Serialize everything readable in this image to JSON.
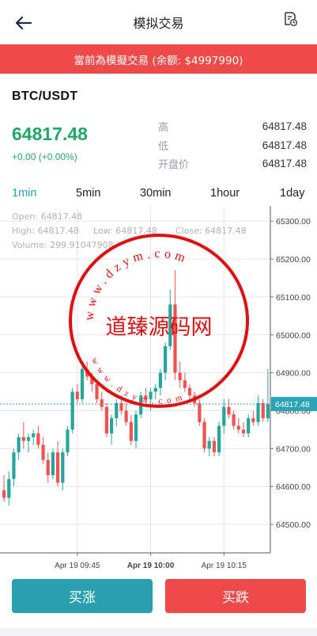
{
  "header": {
    "title": "模拟交易",
    "back_icon": "arrow-left-icon",
    "record_icon": "order-record-icon"
  },
  "banner": {
    "text": "當前為模擬交易 (余额: $4997990)"
  },
  "ticker": {
    "pair": "BTC/USDT",
    "price": "64817.48",
    "change": "+0.00 (+0.00%)",
    "stats": [
      {
        "label": "高",
        "value": "64817.48"
      },
      {
        "label": "低",
        "value": "64817.48"
      },
      {
        "label": "开盘价",
        "value": "64817.48"
      }
    ]
  },
  "tabs": [
    {
      "label": "1min",
      "active": true
    },
    {
      "label": "5min",
      "active": false
    },
    {
      "label": "30min",
      "active": false
    },
    {
      "label": "1hour",
      "active": false
    },
    {
      "label": "1day",
      "active": false
    }
  ],
  "ohlc": {
    "open": "Open:  64817.48",
    "high": "High:  64817.48",
    "low": "Low:  64817.48",
    "close": "Close:  64817.48",
    "volume": "Volume:  299.91047908"
  },
  "chart_data": {
    "type": "candlestick",
    "y_ticks": [
      "65300.00",
      "65200.00",
      "65100.00",
      "65000.00",
      "64900.00",
      "64800.00",
      "64700.00",
      "64600.00",
      "64500.00"
    ],
    "y_tick_values": [
      65300,
      65200,
      65100,
      65000,
      64900,
      64800,
      64700,
      64600,
      64500
    ],
    "ylim": [
      64425,
      65340
    ],
    "x_ticks": [
      "Apr 19 09:45",
      "Apr 19 10:00",
      "Apr 19 10:15"
    ],
    "x_tick_index": [
      15,
      30,
      45
    ],
    "current_price": 64817.48,
    "current_price_label": "64817.48",
    "up_color": "#26a69a",
    "down_color": "#ef5350",
    "candles": [
      [
        64590,
        64630,
        64560,
        64570
      ],
      [
        64570,
        64640,
        64550,
        64620
      ],
      [
        64620,
        64700,
        64600,
        64690
      ],
      [
        64690,
        64740,
        64670,
        64730
      ],
      [
        64730,
        64770,
        64700,
        64720
      ],
      [
        64720,
        64740,
        64690,
        64730
      ],
      [
        64730,
        64750,
        64710,
        64740
      ],
      [
        64740,
        64760,
        64700,
        64710
      ],
      [
        64710,
        64730,
        64660,
        64670
      ],
      [
        64670,
        64690,
        64610,
        64630
      ],
      [
        64630,
        64700,
        64620,
        64690
      ],
      [
        64690,
        64720,
        64600,
        64610
      ],
      [
        64610,
        64700,
        64590,
        64690
      ],
      [
        64690,
        64760,
        64680,
        64750
      ],
      [
        64750,
        64860,
        64740,
        64850
      ],
      [
        64850,
        64870,
        64820,
        64830
      ],
      [
        64830,
        64920,
        64820,
        64910
      ],
      [
        64910,
        64930,
        64880,
        64890
      ],
      [
        64890,
        64900,
        64850,
        64870
      ],
      [
        64870,
        64880,
        64820,
        64830
      ],
      [
        64830,
        64850,
        64800,
        64810
      ],
      [
        64810,
        64820,
        64730,
        64740
      ],
      [
        64740,
        64790,
        64710,
        64780
      ],
      [
        64780,
        64830,
        64760,
        64820
      ],
      [
        64820,
        64840,
        64790,
        64800
      ],
      [
        64800,
        64820,
        64760,
        64770
      ],
      [
        64770,
        64790,
        64710,
        64720
      ],
      [
        64720,
        64800,
        64700,
        64790
      ],
      [
        64790,
        64850,
        64780,
        64840
      ],
      [
        64840,
        64860,
        64820,
        64830
      ],
      [
        64830,
        64860,
        64800,
        64850
      ],
      [
        64850,
        64870,
        64830,
        64860
      ],
      [
        64860,
        64910,
        64840,
        64900
      ],
      [
        64900,
        64980,
        64880,
        64970
      ],
      [
        64970,
        65120,
        64960,
        65080
      ],
      [
        65080,
        65170,
        64880,
        64900
      ],
      [
        64900,
        64930,
        64860,
        64880
      ],
      [
        64880,
        64900,
        64850,
        64860
      ],
      [
        64860,
        64870,
        64830,
        64840
      ],
      [
        64840,
        64850,
        64810,
        64820
      ],
      [
        64820,
        64830,
        64760,
        64770
      ],
      [
        64770,
        64780,
        64690,
        64700
      ],
      [
        64700,
        64730,
        64680,
        64720
      ],
      [
        64720,
        64730,
        64680,
        64690
      ],
      [
        64690,
        64770,
        64680,
        64760
      ],
      [
        64760,
        64830,
        64740,
        64810
      ],
      [
        64810,
        64830,
        64780,
        64790
      ],
      [
        64790,
        64800,
        64750,
        64760
      ],
      [
        64760,
        64780,
        64740,
        64750
      ],
      [
        64750,
        64770,
        64730,
        64740
      ],
      [
        64740,
        64790,
        64730,
        64780
      ],
      [
        64780,
        64800,
        64760,
        64770
      ],
      [
        64770,
        64840,
        64760,
        64820
      ],
      [
        64820,
        64830,
        64770,
        64780
      ],
      [
        64780,
        64910,
        64770,
        64817
      ]
    ]
  },
  "watermark": {
    "url_top": "www.dzym.com",
    "url_bottom": "www.dzym.com",
    "name": "道臻源码网"
  },
  "actions": {
    "buy": "买涨",
    "sell": "买跌"
  }
}
